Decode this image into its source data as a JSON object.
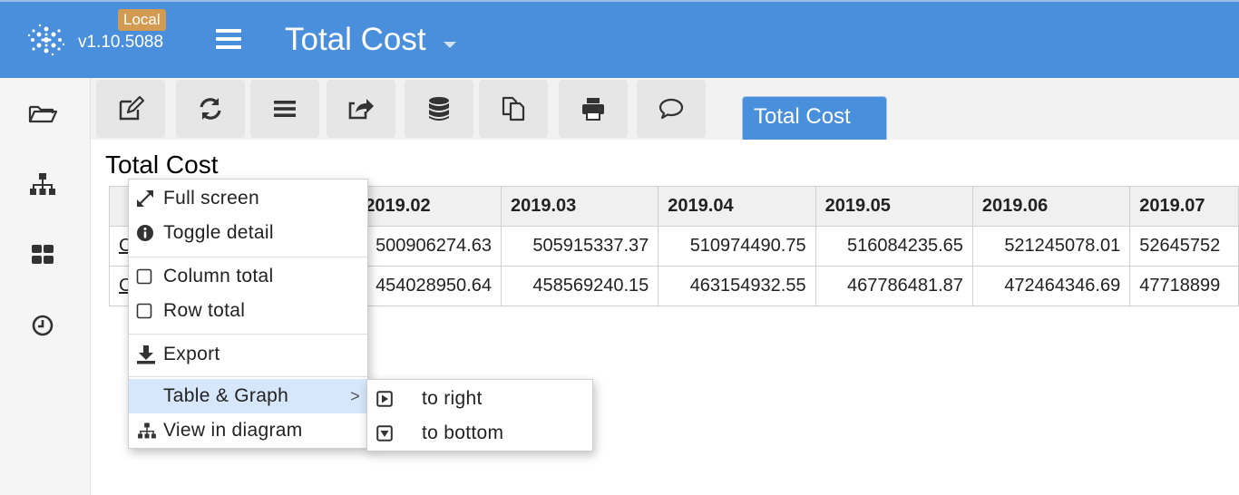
{
  "header": {
    "env_badge": "Local",
    "version": "v1.10.5088",
    "title": "Total Cost",
    "accent": "#4a8fdc",
    "badge_color": "#d39a52"
  },
  "sidebar": {
    "items": [
      {
        "icon": "folder-open-icon"
      },
      {
        "icon": "sitemap-icon"
      },
      {
        "icon": "dashboard-grid-icon"
      },
      {
        "icon": "clock-icon"
      }
    ]
  },
  "toolbar": {
    "buttons": [
      {
        "icon": "edit-icon"
      },
      {
        "icon": "refresh-icon"
      },
      {
        "icon": "list-icon"
      },
      {
        "icon": "share-icon"
      },
      {
        "icon": "database-icon"
      },
      {
        "icon": "copy-icon"
      },
      {
        "icon": "print-icon"
      },
      {
        "icon": "comment-icon"
      }
    ],
    "active_tab": "Total Cost"
  },
  "content": {
    "title": "Total Cost",
    "columns": [
      "2019.02",
      "2019.03",
      "2019.04",
      "2019.05",
      "2019.06",
      "2019.07"
    ],
    "rows": [
      {
        "label": "C",
        "values": [
          "500906274.63",
          "505915337.37",
          "510974490.75",
          "516084235.65",
          "521245078.01",
          "52645752"
        ]
      },
      {
        "label": "C",
        "values": [
          "454028950.64",
          "458569240.15",
          "463154932.55",
          "467786481.87",
          "472464346.69",
          "47718899"
        ]
      }
    ]
  },
  "context_menu": {
    "items": {
      "full_screen": "Full screen",
      "toggle_detail": "Toggle detail",
      "column_total": "Column total",
      "row_total": "Row total",
      "export": "Export",
      "table_graph": "Table & Graph",
      "view_in_diagram": "View in diagram"
    },
    "submenu": {
      "to_right": "to right",
      "to_bottom": "to bottom"
    }
  }
}
